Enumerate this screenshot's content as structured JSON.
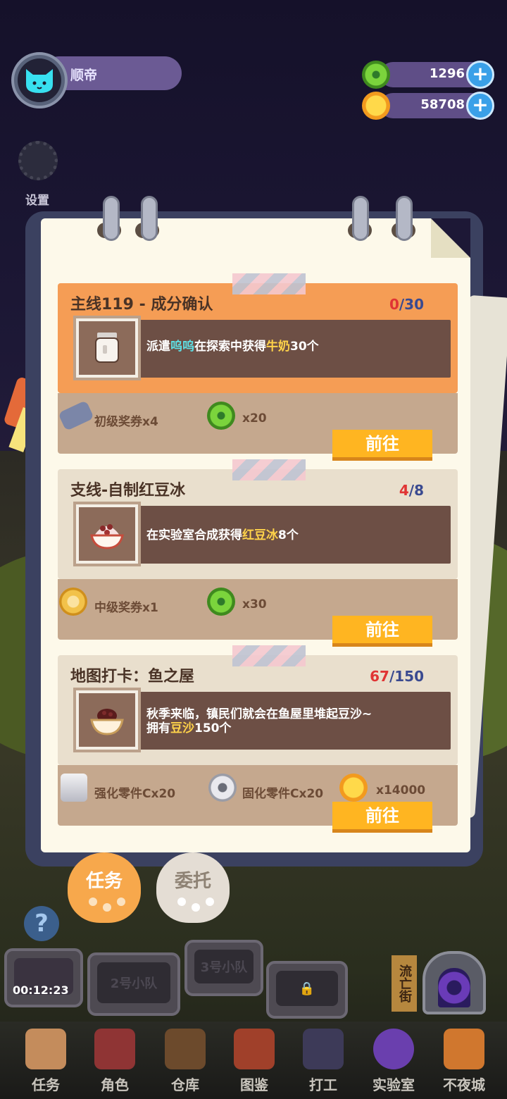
{
  "user": {
    "name": "顺帝"
  },
  "settings": {
    "label": "设置"
  },
  "currency": {
    "donut": {
      "value": "1296",
      "plus": "+"
    },
    "coin": {
      "value": "58708",
      "plus": "+"
    }
  },
  "tasks": [
    {
      "title": "主线119 - 成分确认",
      "progress_current": "0",
      "progress_sep_total": "/30",
      "desc_parts": [
        "派遣",
        "呜呜",
        "在探索中获得",
        "牛奶",
        "30个"
      ],
      "rewards": [
        {
          "icon": "blue-ticket-icon",
          "label": "初级奖券x4"
        },
        {
          "icon": "green-donut-icon",
          "label": "x20"
        }
      ],
      "button": "前往"
    },
    {
      "title": "支线-自制红豆冰",
      "progress_current": "4",
      "progress_sep_total": "/8",
      "desc_parts": [
        "在实验室合成获得",
        "红豆冰",
        "8个"
      ],
      "rewards": [
        {
          "icon": "gold-ticket-icon",
          "label": "中级奖券x1"
        },
        {
          "icon": "green-donut-icon",
          "label": "x30"
        }
      ],
      "button": "前往"
    },
    {
      "title": "地图打卡：鱼之屋",
      "progress_current": "67",
      "progress_sep_total": "/150",
      "desc_line1": "秋季来临，镇民们就会在鱼屋里堆起豆沙~",
      "desc_parts": [
        "拥有",
        "豆沙",
        "150个"
      ],
      "rewards": [
        {
          "icon": "bolt-icon",
          "label": "强化零件Cx20"
        },
        {
          "icon": "nut-icon",
          "label": "固化零件Cx20"
        },
        {
          "icon": "gold-coin-icon",
          "label": "x14000"
        }
      ],
      "button": "前往"
    }
  ],
  "tabs": {
    "active": "任务",
    "inactive": "委托"
  },
  "squads": {
    "timer": "00:12:23",
    "squad2": "2号小队",
    "squad3": "3号小队"
  },
  "street_sign": "流亡街",
  "nav": [
    "任务",
    "角色",
    "仓库",
    "图鉴",
    "打工",
    "实验室",
    "不夜城"
  ],
  "colors": {
    "accent_orange": "#f59d55",
    "button_yellow": "#ffb521",
    "highlight_blue": "#5ee0e6",
    "highlight_gold": "#ffd34a"
  }
}
